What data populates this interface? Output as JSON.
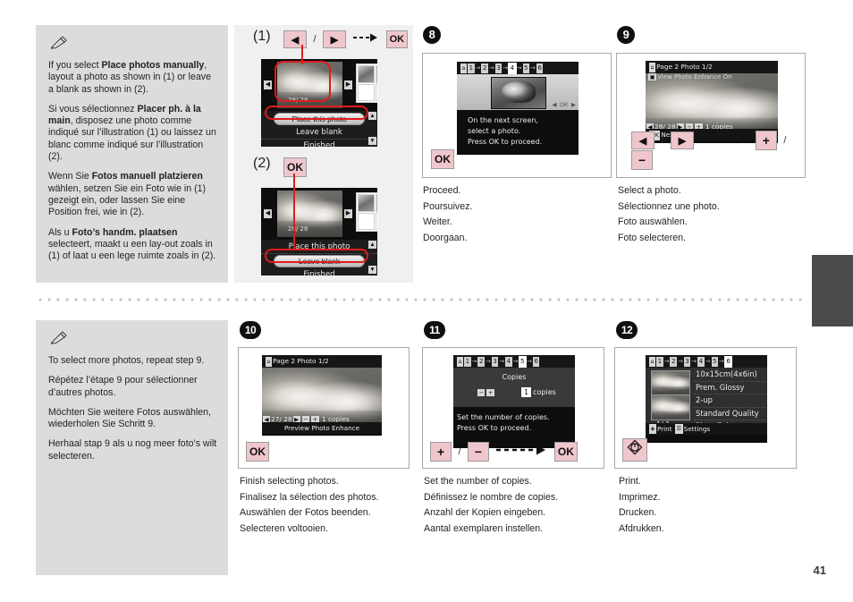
{
  "page": {
    "number": "41"
  },
  "note_top": {
    "icon": "pencil-note-icon",
    "paragraphs": [
      {
        "pre": "If you select ",
        "bold": "Place photos manually",
        "post": ", layout a photo as shown in (1) or leave a blank as shown in (2)."
      },
      {
        "pre": "Si vous sélectionnez ",
        "bold": "Placer ph. à la main",
        "post": ", disposez une photo comme indiqué sur l’illustration (1) ou laissez un blanc comme indiqué sur l’illustration (2)."
      },
      {
        "pre": "Wenn Sie ",
        "bold": "Fotos manuell platzieren",
        "post": " wählen, setzen Sie ein Foto wie in (1) gezeigt ein, oder lassen Sie eine Position frei, wie in (2)."
      },
      {
        "pre": "Als u ",
        "bold": "Foto’s handm. plaatsen",
        "post": " selecteert, maakt u een lay-out zoals in (1) of laat u een lege ruimte zoals in (2)."
      }
    ]
  },
  "note_bottom": {
    "icon": "pencil-note-icon",
    "paragraphs": [
      {
        "pre": "To select more photos, repeat step 9.",
        "bold": "",
        "post": ""
      },
      {
        "pre": "Répétez l’étape 9 pour sélectionner d’autres photos.",
        "bold": "",
        "post": ""
      },
      {
        "pre": "Möchten Sie weitere Fotos auswählen, wiederholen Sie Schritt 9.",
        "bold": "",
        "post": ""
      },
      {
        "pre": "Herhaal stap 9 als u nog meer foto’s wilt selecteren.",
        "bold": "",
        "post": ""
      }
    ]
  },
  "illustration": {
    "label_1": "(1)",
    "label_2": "(2)",
    "keys_1": {
      "left": "◀",
      "slash": "/",
      "right": "▶",
      "arrow": "-->",
      "ok": "OK"
    },
    "keys_2": {
      "ok": "OK"
    },
    "lcd1": {
      "counter": "28/ 28",
      "menu": [
        "Place this photo",
        "Leave blank",
        "Finished"
      ],
      "selected": "Place this photo",
      "nav_left": "◀",
      "nav_right": "▶",
      "scroll_up": "▲",
      "scroll_down": "▼"
    },
    "lcd2": {
      "counter": "28/ 28",
      "menu": [
        "Place this photo",
        "Leave blank",
        "Finished"
      ],
      "selected": "Leave blank",
      "nav_left": "◀",
      "nav_right": "▶",
      "scroll_up": "▲",
      "scroll_down": "▼"
    }
  },
  "steps": [
    {
      "number": "8",
      "badge": "8",
      "lcd": {
        "crumbs": [
          "1",
          "2",
          "3",
          "4",
          "5",
          "6"
        ],
        "crumb_active": "4",
        "message_lines": [
          "On the next screen,",
          "select a photo.",
          "Press  OK  to proceed."
        ],
        "ok_icon_label": "OK"
      },
      "keys": [
        {
          "type": "ok",
          "label": "OK"
        }
      ],
      "caption": [
        "Proceed.",
        "Poursuivez.",
        "Weiter.",
        "Doorgaan."
      ]
    },
    {
      "number": "9",
      "badge": "9",
      "lcd": {
        "title": "Page 2 Photo 1/2",
        "subtitle": "View Photo Enhance On",
        "counter": "28/ 28",
        "copies_value": "1",
        "copies_label": "copies",
        "footer": "Next",
        "footer_icon": "OK",
        "nav_left": "◀",
        "nav_right": "▶",
        "minus": "−",
        "plus": "+"
      },
      "keys": [
        {
          "type": "arrow",
          "label": "◀"
        },
        {
          "type": "slash",
          "label": "/"
        },
        {
          "type": "arrow",
          "label": "▶"
        },
        {
          "type": "dash",
          "label": "----->"
        },
        {
          "type": "pm",
          "label": "+"
        },
        {
          "type": "slash",
          "label": "/"
        },
        {
          "type": "pm",
          "label": "−"
        }
      ],
      "caption": [
        "Select a photo.",
        "Sélectionnez une photo.",
        "Foto auswählen.",
        "Foto selecteren."
      ]
    },
    {
      "number": "10",
      "badge": "10",
      "lcd": {
        "title": "Page 2 Photo 1/2",
        "counter": "27/ 28",
        "copies_value": "1",
        "copies_label": "copies",
        "footer": "Preview Photo Enhance",
        "nav_left": "◀",
        "nav_right": "▶",
        "minus": "−",
        "plus": "+"
      },
      "keys": [
        {
          "type": "ok",
          "label": "OK"
        }
      ],
      "caption": [
        "Finish selecting photos.",
        "Finalisez la sélection des photos.",
        "Auswählen der Fotos beenden.",
        "Selecteren voltooien."
      ]
    },
    {
      "number": "11",
      "badge": "11",
      "lcd": {
        "crumbs": [
          "1",
          "2",
          "3",
          "4",
          "5",
          "6"
        ],
        "crumb_active": "5",
        "heading": "Copies",
        "minus": "−",
        "plus": "+",
        "copies_value": "1",
        "copies_label": "copies",
        "message_lines": [
          "Set the number of copies.",
          "Press  OK  to proceed."
        ]
      },
      "keys": [
        {
          "type": "pm",
          "label": "+"
        },
        {
          "type": "slash",
          "label": "/"
        },
        {
          "type": "pm",
          "label": "−"
        },
        {
          "type": "dash",
          "label": "----->"
        },
        {
          "type": "ok",
          "label": "OK"
        }
      ],
      "caption": [
        "Set the number of copies.",
        "Définissez le nombre de copies.",
        "Anzahl der Kopien eingeben.",
        "Aantal exemplaren instellen."
      ]
    },
    {
      "number": "12",
      "badge": "12",
      "lcd": {
        "crumbs": [
          "1",
          "2",
          "3",
          "4",
          "5",
          "6"
        ],
        "crumb_active": "6",
        "settings": [
          "10x15cm(4x6in)",
          "Prem. Glossy",
          "2-up",
          "Standard Quality",
          "PhotoEnhance"
        ],
        "page_count": "1/ 1",
        "footer_print": "Print",
        "footer_settings": "Settings"
      },
      "keys": [
        {
          "type": "print",
          "label": "◈"
        }
      ],
      "caption": [
        "Print.",
        "Imprimez.",
        "Drucken.",
        "Afdrukken."
      ]
    }
  ]
}
